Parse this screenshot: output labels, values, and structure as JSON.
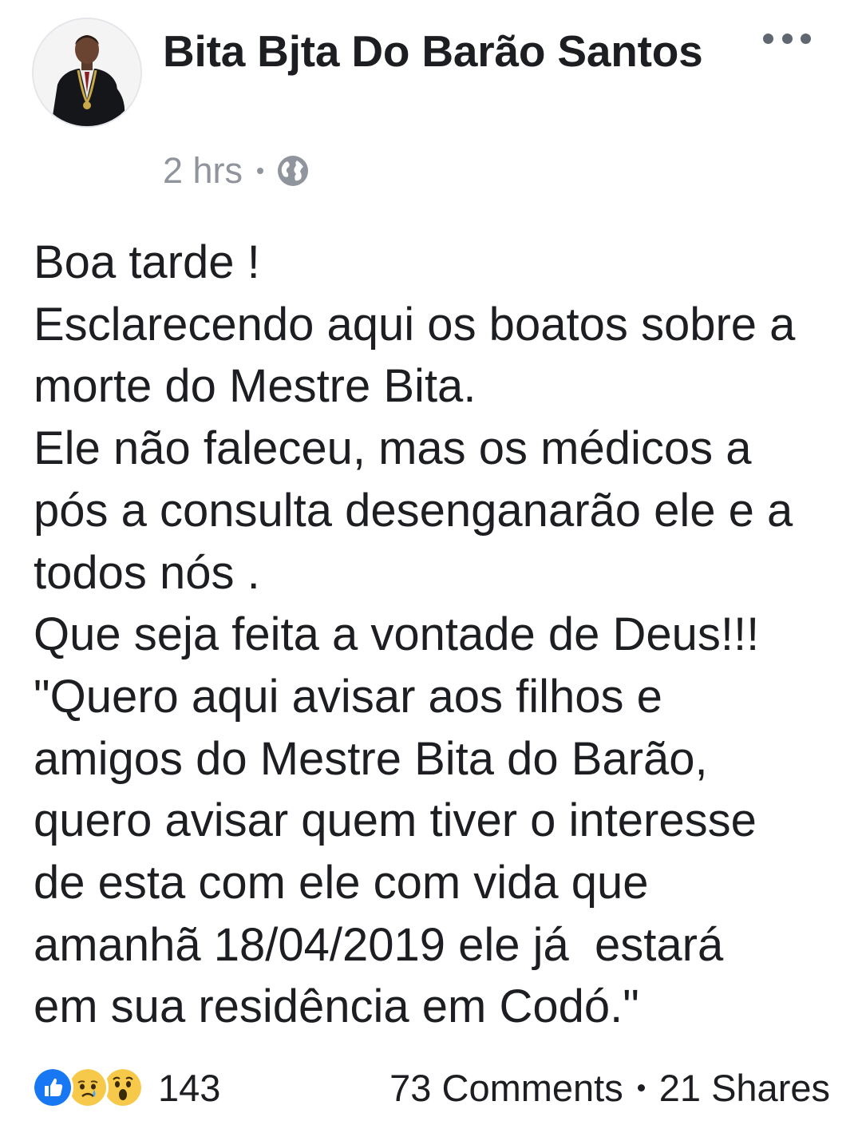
{
  "post": {
    "author": {
      "name": "Bita Bjta Do Barão Santos"
    },
    "timestamp": "2 hrs",
    "privacy_icon": "globe-icon",
    "menu_icon": "more-options-icon",
    "body_lines": [
      "Boa tarde !",
      "Esclarecendo aqui os boatos sobre a",
      "morte do Mestre Bita.",
      "Ele não faleceu, mas os médicos a",
      "pós a consulta desenganarão ele e a",
      "todos nós .",
      "Que seja feita a vontade de Deus!!!",
      "\"Quero aqui avisar aos filhos e",
      "amigos do Mestre Bita do Barão,",
      "quero avisar quem tiver o interesse",
      "de esta com ele com vida que",
      "amanhã 18/04/2019 ele já  estará",
      "em sua residência em Codó.\""
    ],
    "reactions": {
      "types": [
        "like",
        "sad",
        "wow"
      ],
      "count": "143"
    },
    "comments": "73 Comments",
    "shares": "21 Shares"
  },
  "colors": {
    "text": "#1c1e21",
    "meta": "#90949c",
    "like_blue": "#1877f2",
    "emoji_yellow": "#f7c94b"
  }
}
